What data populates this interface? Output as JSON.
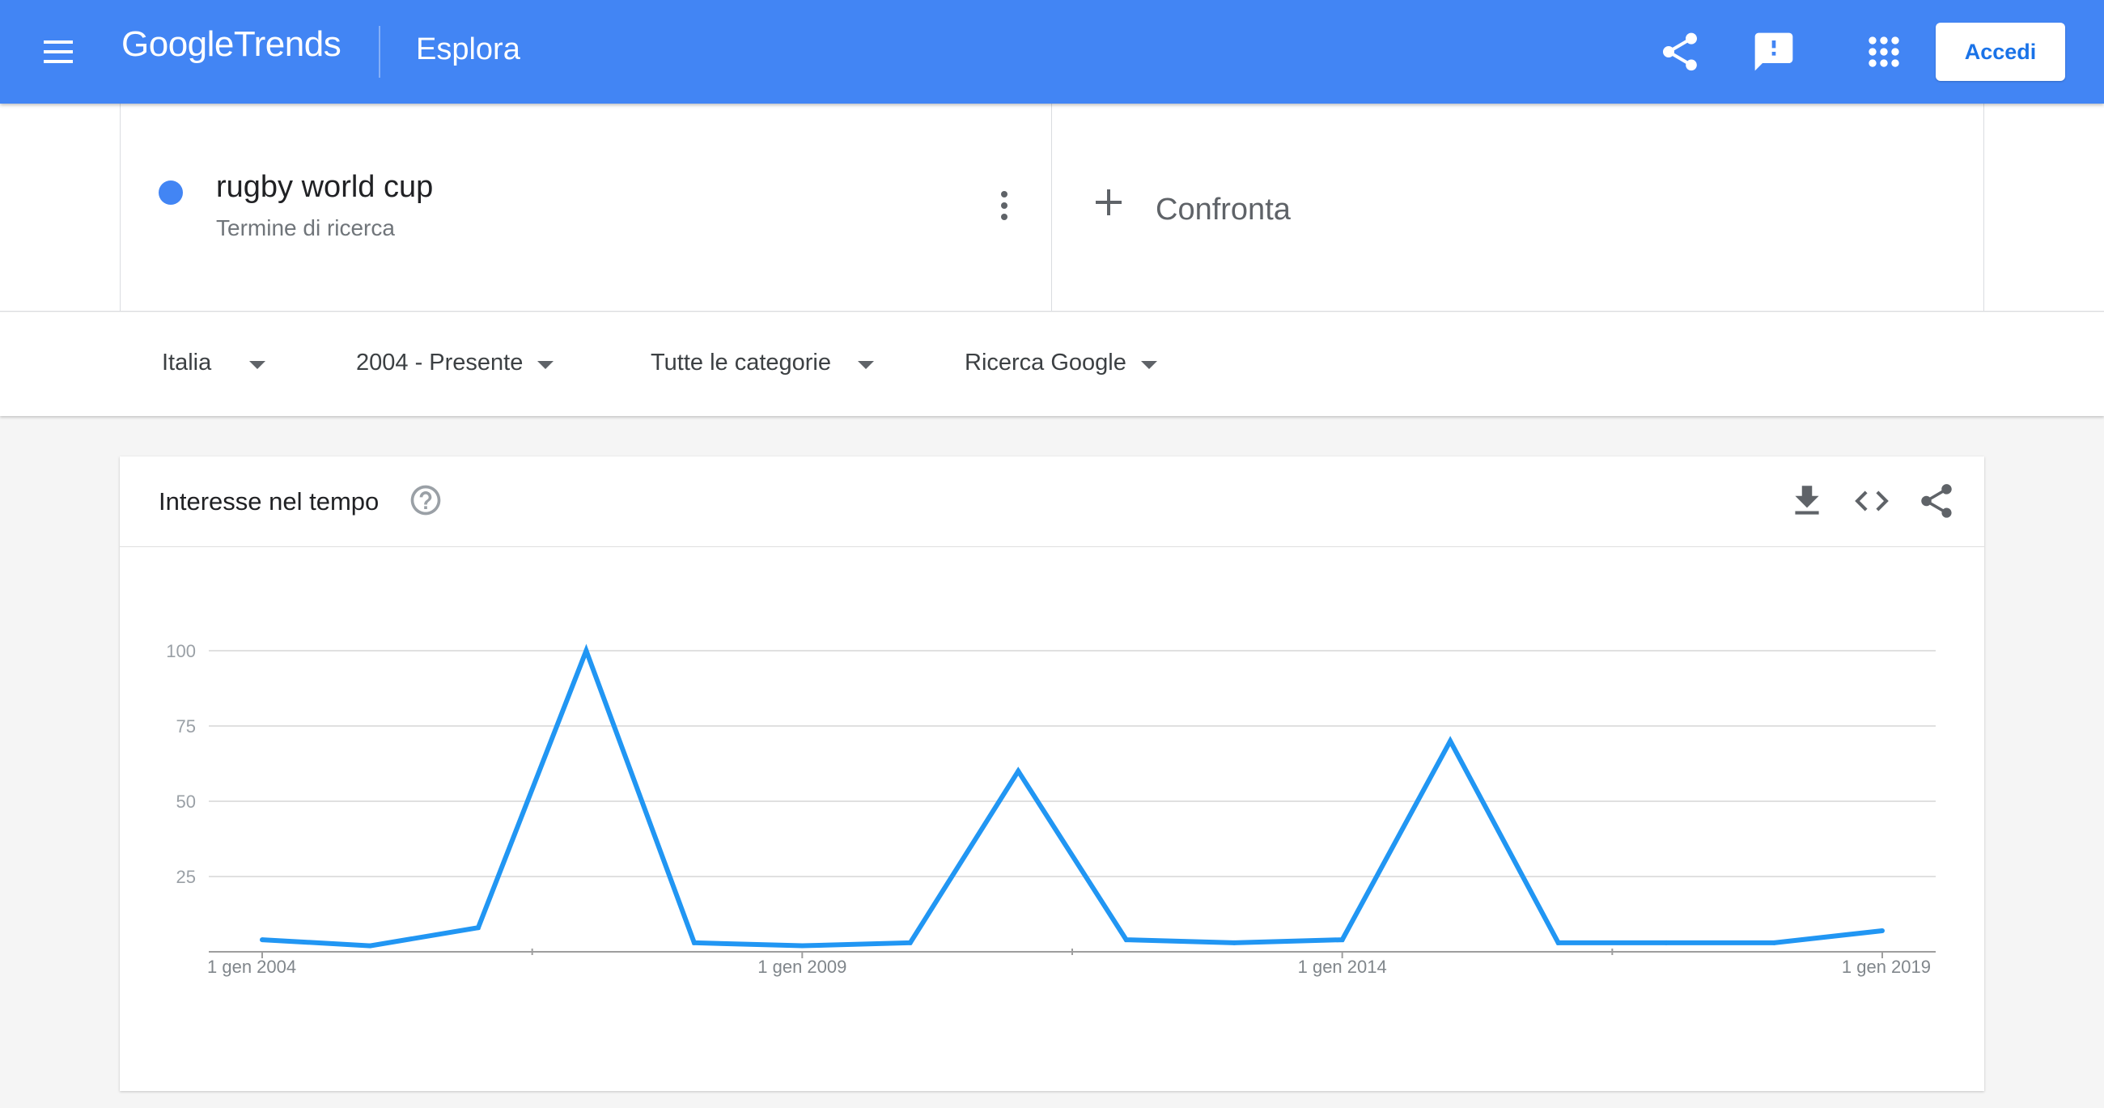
{
  "header": {
    "logo_google": "Google",
    "logo_trends": "Trends",
    "section": "Esplora",
    "signin_label": "Accedi",
    "icons": [
      "menu-icon",
      "share-icon",
      "feedback-icon",
      "apps-icon"
    ],
    "background_color": "#4285f4"
  },
  "term": {
    "name": "rugby world cup",
    "type": "Termine di ricerca",
    "color": "#4285f4"
  },
  "compare": {
    "label": "Confronta"
  },
  "filters": {
    "region": "Italia",
    "period": "2004 - Presente",
    "category": "Tutte le categorie",
    "property": "Ricerca Google"
  },
  "card": {
    "title": "Interesse nel tempo",
    "icons": [
      "help-icon",
      "download-icon",
      "embed-icon",
      "share-icon"
    ]
  },
  "chart_data": {
    "type": "line",
    "title": "",
    "xlabel": "",
    "ylabel": "",
    "x": [
      "2004-01-01",
      "2005-01-01",
      "2006-01-01",
      "2007-01-01",
      "2008-01-01",
      "2009-01-01",
      "2010-01-01",
      "2011-01-01",
      "2012-01-01",
      "2013-01-01",
      "2014-01-01",
      "2015-01-01",
      "2016-01-01",
      "2017-01-01",
      "2018-01-01",
      "2019-01-01"
    ],
    "series": [
      {
        "color": "#2196f3",
        "values": [
          4,
          2,
          8,
          100,
          3,
          2,
          3,
          60,
          4,
          3,
          4,
          70,
          3,
          3,
          3,
          7
        ]
      }
    ],
    "ylim": [
      0,
      100
    ],
    "y_ticks": [
      "25",
      "50",
      "75",
      "100"
    ],
    "x_tick_labels": [
      "1 gen 2004",
      "1 gen 2009",
      "1 gen 2014",
      "1 gen 2019"
    ],
    "grid": true
  }
}
